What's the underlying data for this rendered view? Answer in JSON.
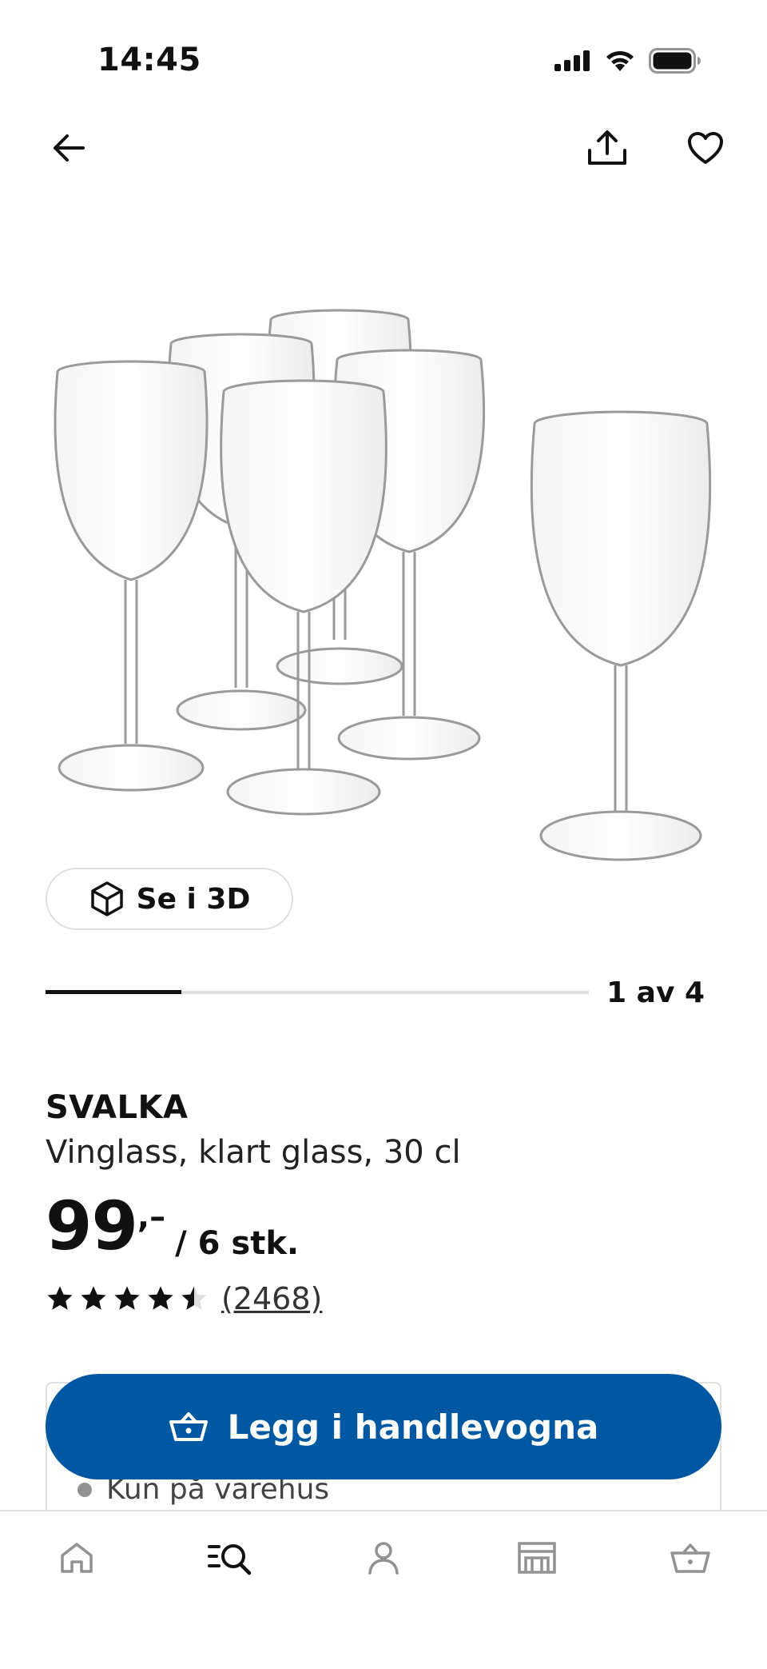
{
  "status_bar": {
    "time": "14:45",
    "icons": [
      "signal-icon",
      "wifi-icon",
      "battery-icon"
    ]
  },
  "top_bar": {
    "icons": [
      "back-arrow-icon",
      "share-icon",
      "heart-icon"
    ]
  },
  "product_image": {
    "icon": "wine-glasses-image"
  },
  "gallery": {
    "see_3d_label": "Se i 3D",
    "counter": "1 av 4",
    "progress_fraction": 0.25
  },
  "product": {
    "name": "SVALKA",
    "description": "Vinglass, klart glass, 30 cl",
    "price_main": "99",
    "price_decimal": ",–",
    "price_unit": "/ 6 stk.",
    "rating": 4.5,
    "rating_count": "(2468)"
  },
  "stock": {
    "availability": "Kun på varehus"
  },
  "actions": {
    "add_to_cart": "Legg i handlevogna"
  },
  "bottom_nav": {
    "items": [
      "home-icon",
      "search-icon",
      "profile-icon",
      "store-icon",
      "cart-icon"
    ]
  },
  "colors": {
    "primary": "#0058a3",
    "text": "#111111",
    "divider": "#dfdfdf"
  }
}
